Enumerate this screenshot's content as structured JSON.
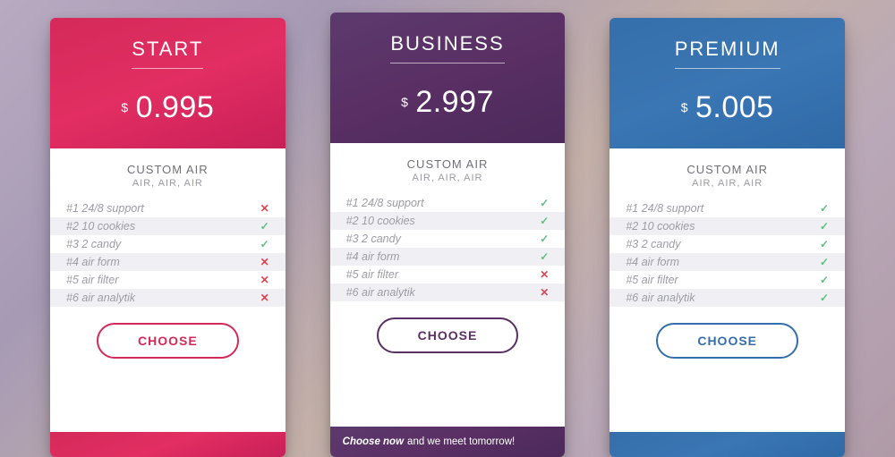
{
  "plans": [
    {
      "name": "START",
      "currency": "$",
      "price": "0.995",
      "subtitle": "CUSTOM AIR",
      "subsub": "AIR, AIR, AIR",
      "features": [
        {
          "label": "#1 24/8 support",
          "included": false
        },
        {
          "label": "#2 10 cookies",
          "included": true
        },
        {
          "label": "#3 2 candy",
          "included": true
        },
        {
          "label": "#4 air form",
          "included": false
        },
        {
          "label": "#5 air filter",
          "included": false
        },
        {
          "label": "#6 air analytik",
          "included": false
        }
      ],
      "cta": "CHOOSE",
      "footer": ""
    },
    {
      "name": "BUSINESS",
      "currency": "$",
      "price": "2.997",
      "subtitle": "CUSTOM AIR",
      "subsub": "AIR, AIR, AIR",
      "features": [
        {
          "label": "#1 24/8 support",
          "included": true
        },
        {
          "label": "#2 10 cookies",
          "included": true
        },
        {
          "label": "#3 2 candy",
          "included": true
        },
        {
          "label": "#4 air form",
          "included": true
        },
        {
          "label": "#5 air filter",
          "included": false
        },
        {
          "label": "#6 air analytik",
          "included": false
        }
      ],
      "cta": "CHOOSE",
      "footer_em": "Choose now",
      "footer_rest": "and we meet tomorrow!"
    },
    {
      "name": "PREMIUM",
      "currency": "$",
      "price": "5.005",
      "subtitle": "CUSTOM AIR",
      "subsub": "AIR, AIR, AIR",
      "features": [
        {
          "label": "#1 24/8 support",
          "included": true
        },
        {
          "label": "#2 10 cookies",
          "included": true
        },
        {
          "label": "#3 2 candy",
          "included": true
        },
        {
          "label": "#4 air form",
          "included": true
        },
        {
          "label": "#5 air filter",
          "included": true
        },
        {
          "label": "#6 air analytik",
          "included": true
        }
      ],
      "cta": "CHOOSE",
      "footer": ""
    }
  ]
}
